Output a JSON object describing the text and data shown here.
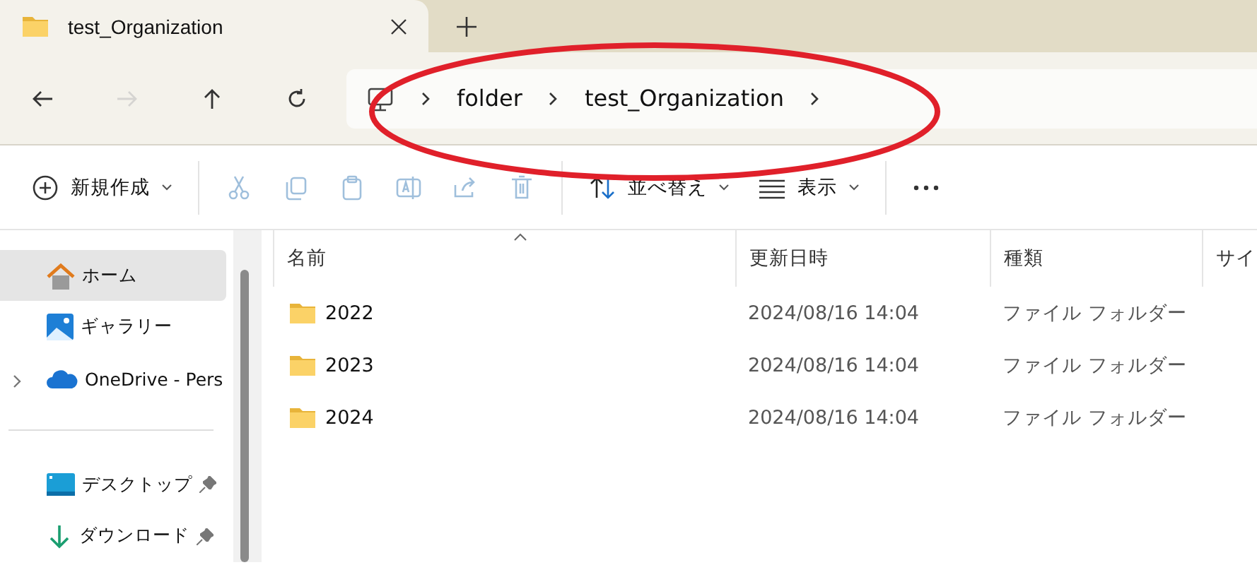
{
  "tabs": [
    {
      "title": "test_Organization",
      "selected": true
    }
  ],
  "nav": [
    {
      "kind": "back",
      "disabled": false
    },
    {
      "kind": "forward",
      "disabled": true
    },
    {
      "kind": "up",
      "disabled": false
    },
    {
      "kind": "refresh",
      "disabled": false
    }
  ],
  "breadcrumb": [
    "folder",
    "test_Organization"
  ],
  "toolbar": [
    {
      "kind": "new",
      "label": "新規作成",
      "disabled": false
    },
    {
      "kind": "cut",
      "disabled": true
    },
    {
      "kind": "copy",
      "disabled": true
    },
    {
      "kind": "paste",
      "disabled": true
    },
    {
      "kind": "rename",
      "disabled": true
    },
    {
      "kind": "share",
      "disabled": true
    },
    {
      "kind": "delete",
      "disabled": true
    },
    {
      "kind": "sort",
      "label": "並べ替え",
      "disabled": false
    },
    {
      "kind": "view",
      "label": "表示",
      "disabled": false
    },
    {
      "kind": "more",
      "disabled": false
    }
  ],
  "sidebar": {
    "items": [
      {
        "kind": "home",
        "label": "ホーム",
        "selected": true
      },
      {
        "kind": "gallery",
        "label": "ギャラリー",
        "selected": false
      },
      {
        "kind": "cloud",
        "label": "OneDrive - Pers",
        "selected": false,
        "expandable": true
      },
      {
        "kind": "desktop",
        "label": "デスクトップ",
        "selected": false,
        "pinned": true
      },
      {
        "kind": "download",
        "label": "ダウンロード",
        "selected": false,
        "pinned": true
      }
    ]
  },
  "table": {
    "columns": [
      "名前",
      "更新日時",
      "種類",
      "サイ"
    ],
    "rows": [
      {
        "name": "2022",
        "modified": "2024/08/16 14:04",
        "type": "ファイル フォルダー"
      },
      {
        "name": "2023",
        "modified": "2024/08/16 14:04",
        "type": "ファイル フォルダー"
      },
      {
        "name": "2024",
        "modified": "2024/08/16 14:04",
        "type": "ファイル フォルダー"
      }
    ]
  }
}
